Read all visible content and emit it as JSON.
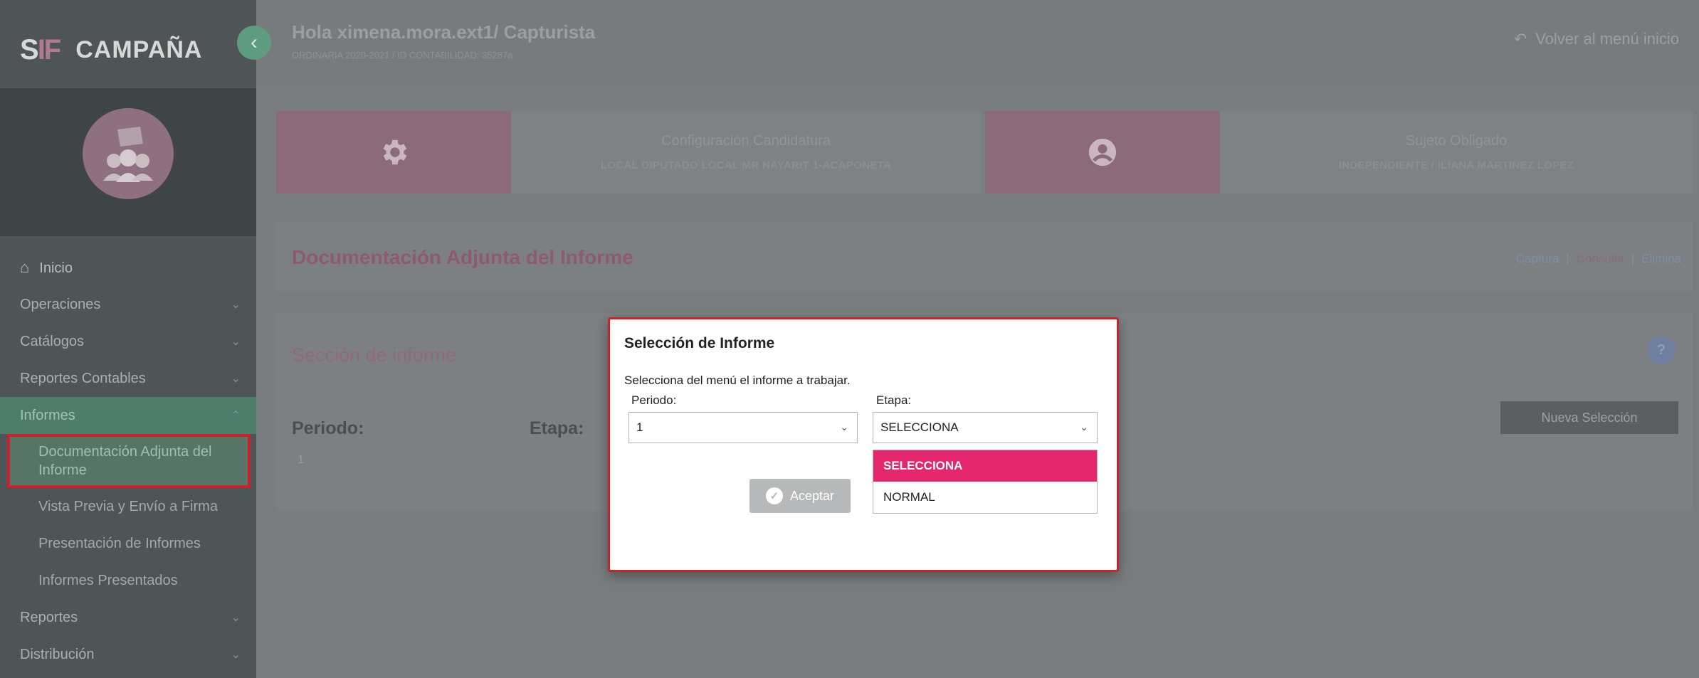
{
  "app": {
    "logo_mark": "S",
    "logo_mark_v": "IF",
    "logo_word": "CAMPAÑA"
  },
  "sidebar": {
    "items": [
      {
        "label": "Inicio"
      },
      {
        "label": "Operaciones"
      },
      {
        "label": "Catálogos"
      },
      {
        "label": "Reportes Contables"
      },
      {
        "label": "Informes"
      },
      {
        "label": "Reportes"
      },
      {
        "label": "Distribución"
      }
    ],
    "sub_items": [
      {
        "label": "Documentación Adjunta del Informe"
      },
      {
        "label": "Vista Previa y Envío a Firma"
      },
      {
        "label": "Presentación de Informes"
      },
      {
        "label": "Informes Presentados"
      }
    ]
  },
  "header": {
    "greeting": "Hola ximena.mora.ext1/ Capturista",
    "subtitle": "ORDINARIA 2020-2021 / ID CONTABILIDAD: 35287a",
    "back_label": "Volver al menú inicio"
  },
  "cards": [
    {
      "title": "Configuración Candidatura",
      "detail": "LOCAL DIPUTADO LOCAL MR NAYARIT 1-ACAPONETA"
    },
    {
      "title": "Sujeto Obligado",
      "detail": "INDEPENDIENTE / ILIANA MARTINEZ LOPEZ"
    }
  ],
  "page": {
    "title": "Documentación Adjunta del Informe",
    "links": [
      "Captura",
      "Consulta",
      "Elimina"
    ],
    "section_title": "Sección de informe",
    "help": "?",
    "periodo_label": "Periodo:",
    "etapa_label": "Etapa:",
    "periodo_value": "1",
    "new_selection": "Nueva Selección"
  },
  "modal": {
    "title": "Selección de Informe",
    "description": "Selecciona del menú el informe a trabajar.",
    "periodo_label": "Periodo:",
    "periodo_value": "1",
    "etapa_label": "Etapa:",
    "etapa_value": "SELECCIONA",
    "accept_label": "Aceptar",
    "etapa_options": [
      "SELECCIONA",
      "NORMAL"
    ]
  },
  "colors": {
    "accent_pink": "#e5286e",
    "highlight_red": "#c8232c",
    "sidebar_active": "#4f7d6c"
  }
}
